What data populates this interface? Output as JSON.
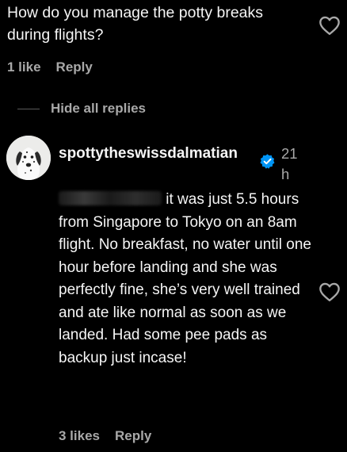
{
  "top_comment": {
    "text": "How do you manage the potty breaks during flights?",
    "likes_label": "1 like",
    "reply_label": "Reply"
  },
  "replies_toggle": {
    "label": "Hide all replies"
  },
  "reply": {
    "username": "spottytheswissdalmatian",
    "timestamp": "21 h",
    "mention_redacted": true,
    "text": "it was just 5.5 hours from Singapore to Tokyo on an 8am flight. No breakfast, no water until one hour before landing and she was perfectly fine, she’s very well trained and ate like normal as soon as we landed. Had some pee pads as backup just incase!",
    "likes_label": "3 likes",
    "reply_label": "Reply"
  },
  "icons": {
    "like": "heart-outline-icon",
    "verified": "verified-badge-icon",
    "avatar": "dalmatian-avatar"
  },
  "colors": {
    "background": "#000000",
    "primary_text": "#f5f5f5",
    "secondary_text": "#a8a8a8",
    "verified_blue": "#0095f6"
  }
}
